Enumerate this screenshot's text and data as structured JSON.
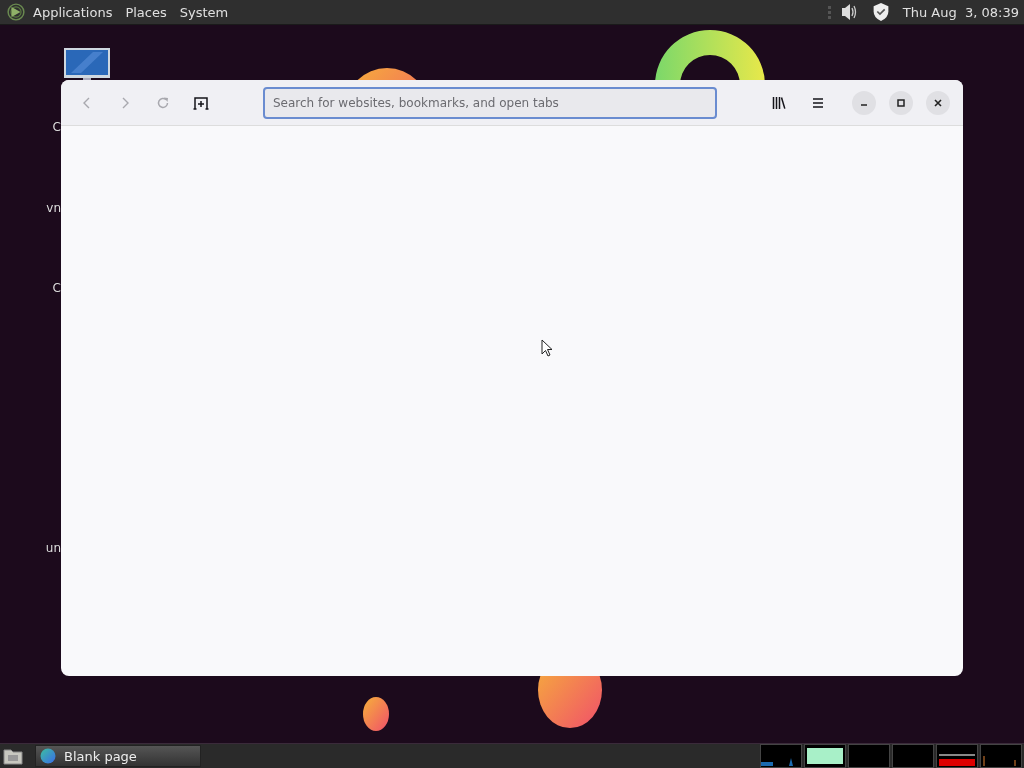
{
  "top_panel": {
    "menus": [
      "Applications",
      "Places",
      "System"
    ],
    "clock": "Thu Aug  3, 08:39"
  },
  "desktop": {
    "icon_labels": [
      {
        "text": "C"
      },
      {
        "text": "vn"
      },
      {
        "text": "C"
      },
      {
        "text": "un"
      }
    ]
  },
  "browser": {
    "toolbar_buttons": [
      {
        "kind": "back",
        "disabled": true
      },
      {
        "kind": "forward",
        "disabled": true
      },
      {
        "kind": "reload",
        "disabled": true
      },
      {
        "kind": "new-tab",
        "disabled": false
      }
    ],
    "search": {
      "placeholder": "Search for websites, bookmarks, and open tabs",
      "focused": true
    },
    "right_buttons": [
      {
        "kind": "library"
      },
      {
        "kind": "menu"
      }
    ],
    "window_buttons": [
      {
        "kind": "minimize"
      },
      {
        "kind": "maximize"
      },
      {
        "kind": "close"
      }
    ]
  },
  "taskbar": {
    "tasks": [
      {
        "label": "Blank page",
        "selected": false
      }
    ]
  }
}
